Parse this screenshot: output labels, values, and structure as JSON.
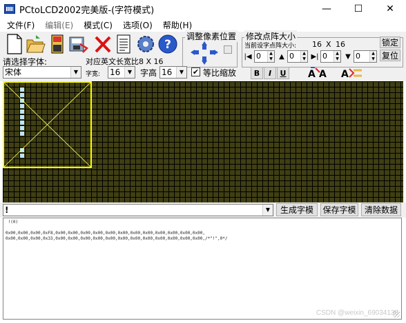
{
  "window": {
    "title": "PCtoLCD2002完美版-(字符模式)",
    "controls": {
      "minimize": "—",
      "maximize": "☐",
      "close": "✕"
    }
  },
  "menu": [
    {
      "label": "文件(F)",
      "enabled": true
    },
    {
      "label": "编辑(E)",
      "enabled": false
    },
    {
      "label": "模式(C)",
      "enabled": true
    },
    {
      "label": "选项(O)",
      "enabled": true
    },
    {
      "label": "帮助(H)",
      "enabled": true
    }
  ],
  "toolbar": {
    "icons": [
      "new-icon",
      "open-icon",
      "save-icon",
      "save-as-icon",
      "delete-icon",
      "notes-icon",
      "settings-gear-icon",
      "help-icon"
    ],
    "pixel_adjust_label": "调整像素位置",
    "matrix_size_label": "修改点阵大小",
    "current_size_label": "当前设字点阵大小:",
    "current_size_w": "16",
    "current_size_x": "X",
    "current_size_h": "16",
    "lock_label": "锁定",
    "reset_label": "复位",
    "spins": [
      "0",
      "0",
      "0",
      "0"
    ],
    "font_select_label": "请选择字体:",
    "font_value": "宋体",
    "eng_ratio_label": "对应英文长宽比8 X 16",
    "char_width_label": "字宽:",
    "char_width_value": "16",
    "char_height_label": "字高",
    "char_height_value": "16",
    "scale_label": "等比缩放",
    "scale_checked": "✔",
    "bold_label": "B",
    "italic_label": "I",
    "underline_label": "U"
  },
  "canvas": {
    "grid_color": "#403f14",
    "pixel_on_color": "#bde6f5",
    "selection_color": "#ffff00"
  },
  "input": {
    "text": "!",
    "generate_label": "生成字模",
    "save_label": "保存字模",
    "clear_label": "清除数据"
  },
  "output": {
    "line1": " !(0)",
    "line2": "",
    "line3": "0x00,0x00,0x00,0xF8,0x00,0x00,0x00,0x00,0x00,0x00,0x00,0x00,0x00,0x00,0x00,0x00,",
    "line4": "0x00,0x00,0x00,0x33,0x00,0x00,0x00,0x00,0x00,0x00,0x00,0x00,0x00,0x00,0x00,0x00,/*\"!\",0*/",
    "watermark": "CSDN @weixin_69034136"
  }
}
